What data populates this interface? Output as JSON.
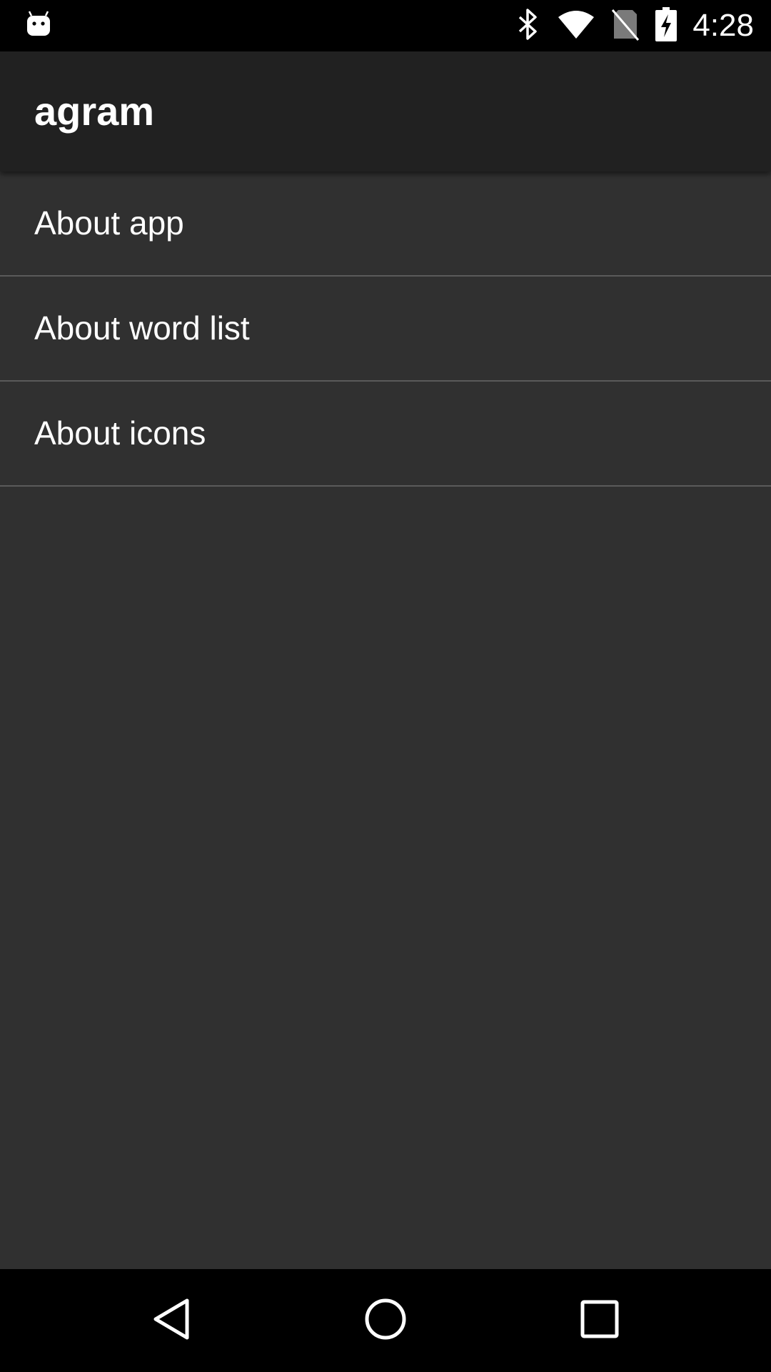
{
  "status_bar": {
    "time": "4:28",
    "notification_icon": "android-debug-icon",
    "icons": [
      "bluetooth-icon",
      "wifi-icon",
      "no-sim-icon",
      "battery-charging-icon"
    ]
  },
  "app_bar": {
    "title": "agram"
  },
  "list": {
    "items": [
      {
        "label": "About app"
      },
      {
        "label": "About word list"
      },
      {
        "label": "About icons"
      }
    ]
  },
  "nav_bar": {
    "buttons": [
      "back",
      "home",
      "recents"
    ]
  },
  "colors": {
    "status_bar_bg": "#000000",
    "app_bar_bg": "#212121",
    "background": "#303030",
    "divider": "#5a5a5a",
    "text": "#ffffff"
  }
}
